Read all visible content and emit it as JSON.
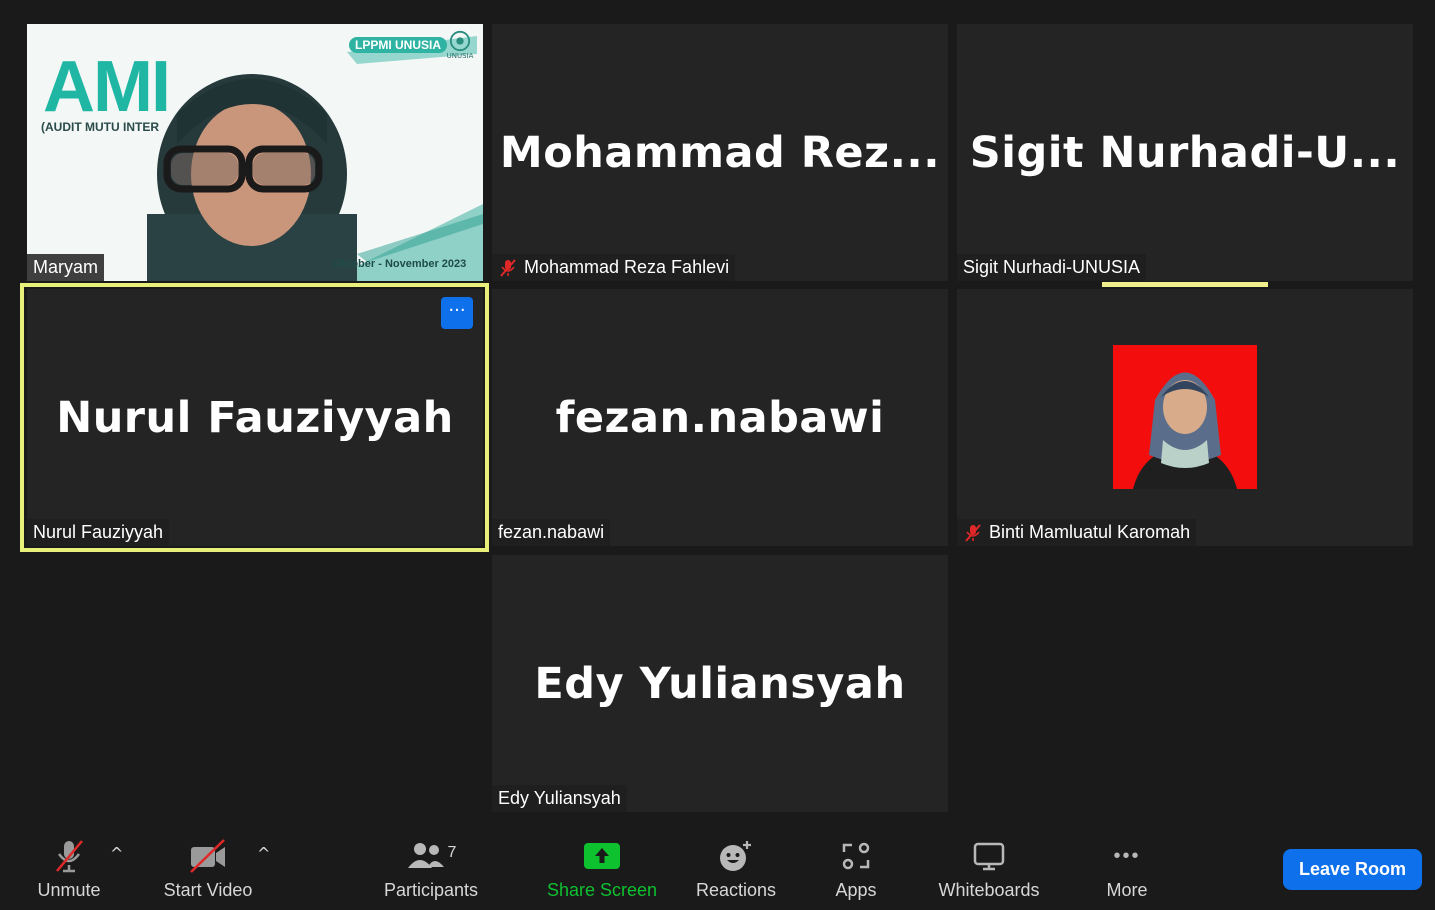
{
  "tiles": [
    {
      "display_name": "",
      "name_tag": "Maryam",
      "muted": false,
      "banner": {
        "title": "AMI",
        "subtitle": "(AUDIT MUTU INTER",
        "org": "LPPMI UNUSIA",
        "logo_text": "UNUSIA",
        "dates": "Oktober - November 2023"
      }
    },
    {
      "display_name": "Mohammad  Rez...",
      "name_tag": "Mohammad Reza Fahlevi",
      "muted": true
    },
    {
      "display_name": "Sigit  Nurhadi-U...",
      "name_tag": "Sigit Nurhadi-UNUSIA",
      "muted": false
    },
    {
      "display_name": "Nurul Fauziyyah",
      "name_tag": "Nurul Fauziyyah",
      "muted": false,
      "more_label": "···"
    },
    {
      "display_name": "fezan.nabawi",
      "name_tag": "fezan.nabawi",
      "muted": false
    },
    {
      "display_name": "",
      "name_tag": "Binti Mamluatul Karomah",
      "muted": true
    },
    {
      "display_name": "Edy Yuliansyah",
      "name_tag": "Edy Yuliansyah",
      "muted": false
    }
  ],
  "toolbar": {
    "unmute": "Unmute",
    "start_video": "Start Video",
    "participants": "Participants",
    "participants_count": "7",
    "share_screen": "Share Screen",
    "reactions": "Reactions",
    "apps": "Apps",
    "whiteboards": "Whiteboards",
    "more": "More",
    "more_glyph": "•••",
    "caret": "^",
    "leave": "Leave Room"
  },
  "colors": {
    "accent": "#0e71eb",
    "share_green": "#0ec12f",
    "active_border": "#e9f07a",
    "muted_red": "#e02828",
    "tile_bg": "#242424"
  }
}
